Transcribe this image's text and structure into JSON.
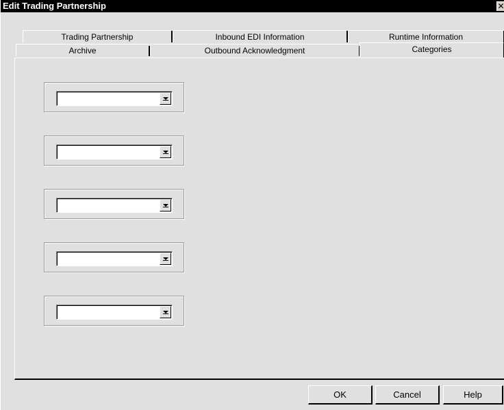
{
  "window": {
    "title": "Edit Trading Partnership",
    "close_symbol": "✕"
  },
  "tabs": {
    "row_back": [
      {
        "label": "Trading Partnership"
      },
      {
        "label": "Inbound EDI Information"
      },
      {
        "label": "Runtime Information"
      }
    ],
    "row_front": [
      {
        "label": "Archive"
      },
      {
        "label": "Outbound Acknowledgment"
      },
      {
        "label": "Categories"
      }
    ],
    "selected": "Categories"
  },
  "categories": [
    {
      "value": ""
    },
    {
      "value": ""
    },
    {
      "value": ""
    },
    {
      "value": ""
    },
    {
      "value": ""
    }
  ],
  "buttons": {
    "ok": "OK",
    "cancel": "Cancel",
    "help": "Help"
  },
  "icons": {
    "dropdown": "chevron-down-icon",
    "close": "close-icon"
  }
}
